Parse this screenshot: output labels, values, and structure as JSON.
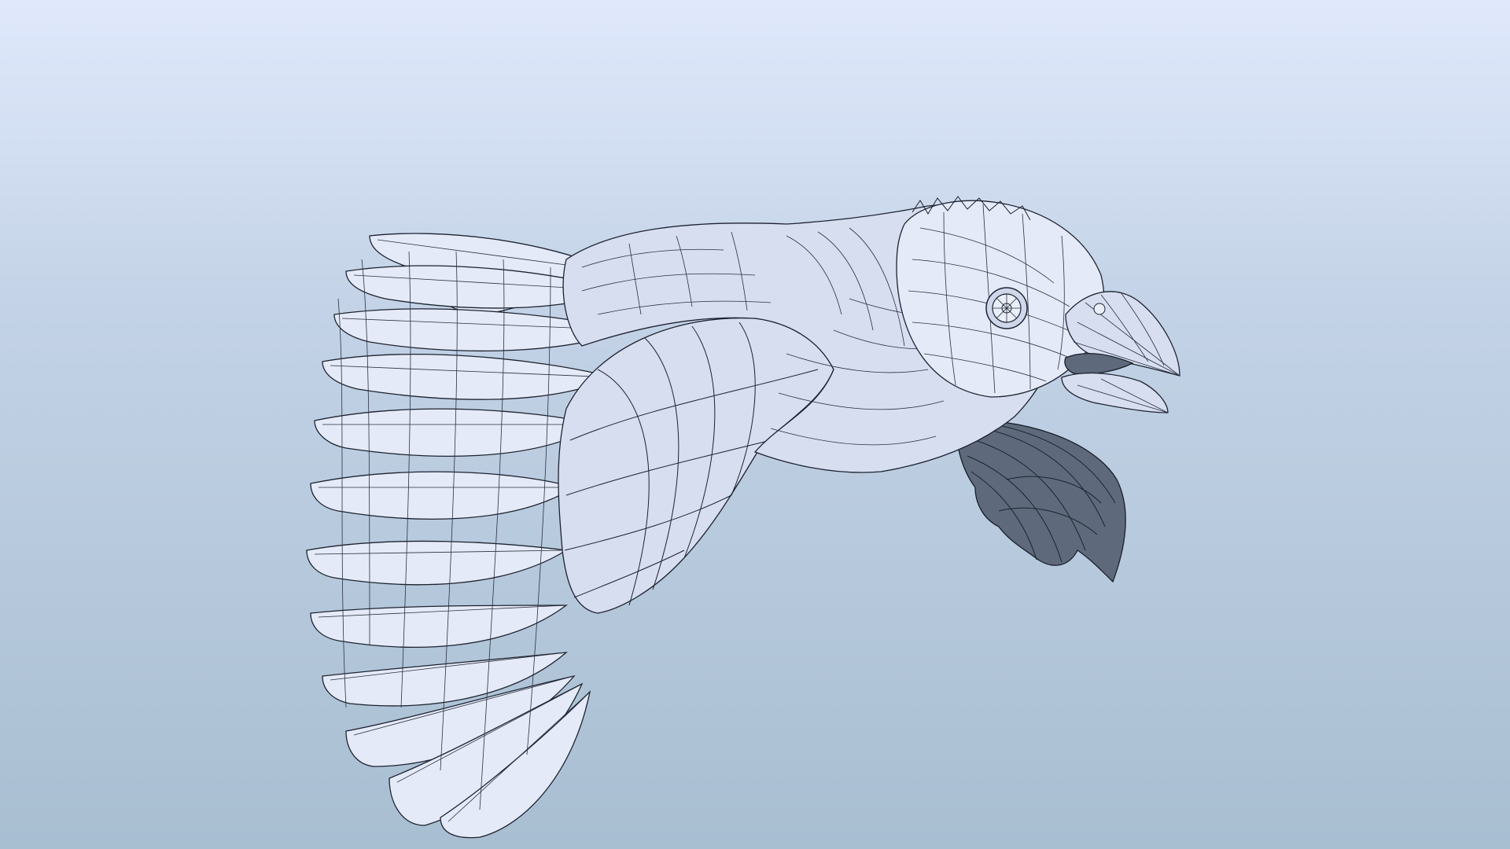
{
  "scene": {
    "subject": "bird-wireframe-model",
    "render_mode": "shaded-wireframe",
    "background_top_color": "#dfe8fb",
    "background_bottom_color": "#a9bfd2",
    "model_base_color": "#d6deef",
    "wire_color": "#1d2230",
    "shadow_wing_color": "#5e6a7b"
  }
}
